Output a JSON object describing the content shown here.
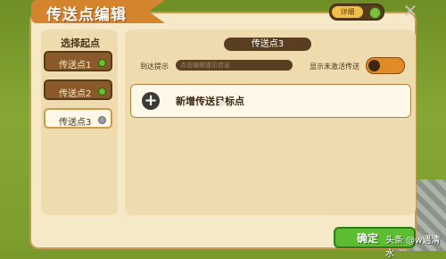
{
  "window": {
    "title": "传送点编辑",
    "detail_label": "详细"
  },
  "start_points": {
    "heading": "选择起点",
    "items": [
      {
        "label": "传送点1"
      },
      {
        "label": "传送点2"
      },
      {
        "label": "传送点3"
      }
    ]
  },
  "editor": {
    "point_name": "传送点3",
    "arrive_label": "到达提示",
    "arrive_placeholder": "点击编辑提示信息",
    "show_label": "显示未激活传送",
    "add_label": "新增传送目标点"
  },
  "footer": {
    "confirm_label": "确定",
    "watermark": "头条 @w遇清水"
  },
  "colors": {
    "panel": "#f5e9c8",
    "title_tab": "#d3842d",
    "selected_item": "#8a5a2a",
    "toggle_on": "#e08a28",
    "confirm": "#5cbc32"
  },
  "icons": [
    "close-icon",
    "plus-icon",
    "status-dot-icon",
    "cursor-icon"
  ]
}
